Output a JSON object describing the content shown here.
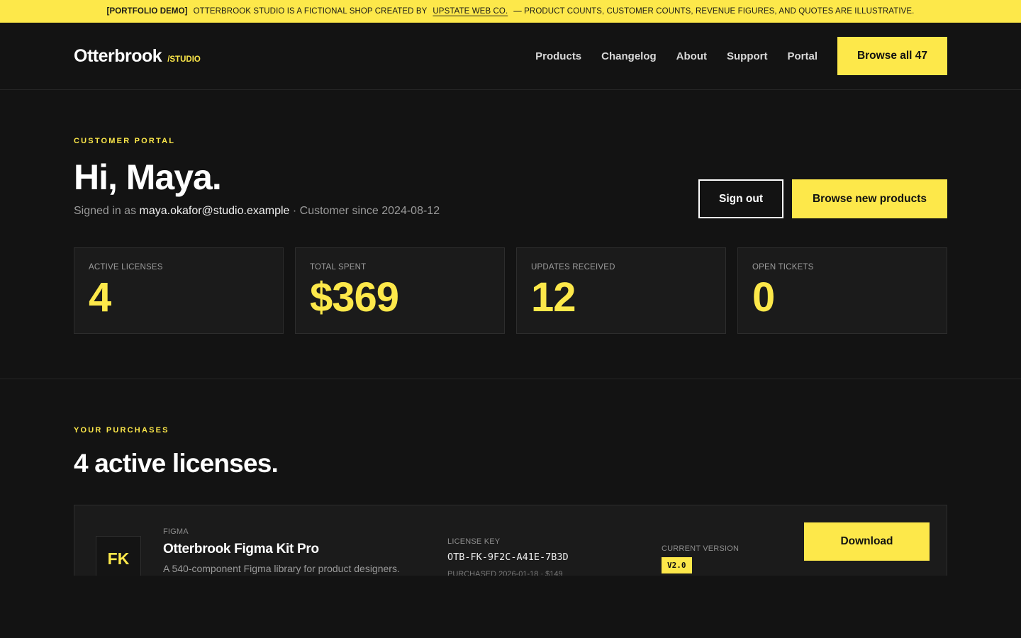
{
  "banner": {
    "tag": "[PORTFOLIO DEMO]",
    "text_before": "OTTERBROOK STUDIO IS A FICTIONAL SHOP CREATED BY",
    "link": "UPSTATE WEB CO.",
    "text_after": "— PRODUCT COUNTS, CUSTOMER COUNTS, REVENUE FIGURES, AND QUOTES ARE ILLUSTRATIVE."
  },
  "header": {
    "logo_name": "Otterbrook",
    "logo_sub": "/STUDIO",
    "nav": [
      "Products",
      "Changelog",
      "About",
      "Support",
      "Portal"
    ],
    "cta": "Browse all 47"
  },
  "hero": {
    "eyebrow": "CUSTOMER PORTAL",
    "greeting": "Hi, Maya.",
    "signed_prefix": "Signed in as",
    "email": "maya.okafor@studio.example",
    "since": "· Customer since 2024-08-12",
    "sign_out": "Sign out",
    "browse_new": "Browse new products"
  },
  "stats": [
    {
      "label": "ACTIVE LICENSES",
      "value": "4"
    },
    {
      "label": "TOTAL SPENT",
      "value": "$369"
    },
    {
      "label": "UPDATES RECEIVED",
      "value": "12"
    },
    {
      "label": "OPEN TICKETS",
      "value": "0"
    }
  ],
  "purchases": {
    "eyebrow": "YOUR PURCHASES",
    "title": "4 active licenses.",
    "items": [
      {
        "badge": "FK",
        "category": "FIGMA",
        "name": "Otterbrook Figma Kit Pro",
        "description": "A 540-component Figma library for product designers.",
        "license_label": "LICENSE KEY",
        "license_key": "OTB-FK-9F2C-A41E-7B3D",
        "purchased": "PURCHASED 2026-01-18 · $149",
        "version_label": "CURRENT VERSION",
        "version": "V2.0",
        "download": "Download"
      }
    ]
  },
  "colors": {
    "accent": "#fde84a",
    "background": "#131313",
    "card": "#1b1b1b"
  }
}
